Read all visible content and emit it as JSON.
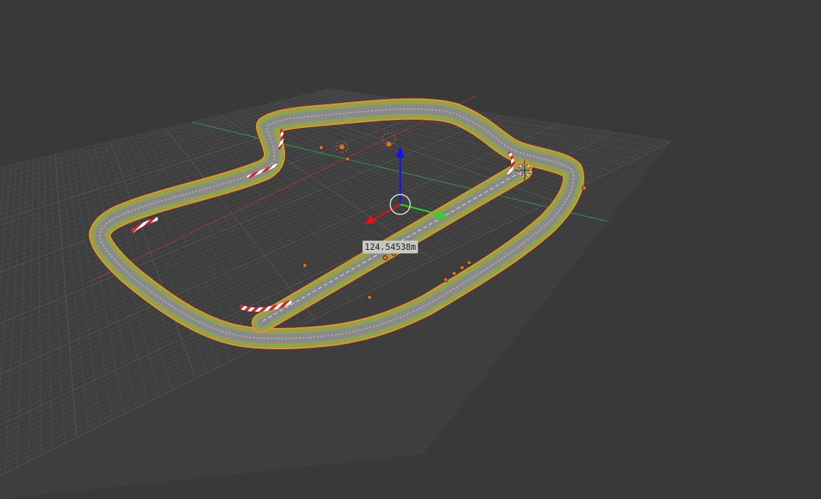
{
  "viewport": {
    "background": "#393939",
    "grid_color": "#585858",
    "x_axis_color": "#c04040",
    "y_axis_color": "#3aa23a"
  },
  "track": {
    "asphalt_color": "#8c8c8c",
    "grass_color": "#8ea34a",
    "selection_outline_color": "#f0902a",
    "curb_colors": [
      "#e02020",
      "#ffffff"
    ]
  },
  "gizmo": {
    "z_handle_color": "#1010ff",
    "y_handle_color": "#20e020",
    "x_handle_color": "#ee1010",
    "center_ring_color": "#ffffff"
  },
  "objects": {
    "marker_color": "#e0701e",
    "lamp_icon": "sun-lamp-icon",
    "cursor_icon": "3d-cursor-icon"
  },
  "measurement": {
    "label": "124.54538m"
  }
}
